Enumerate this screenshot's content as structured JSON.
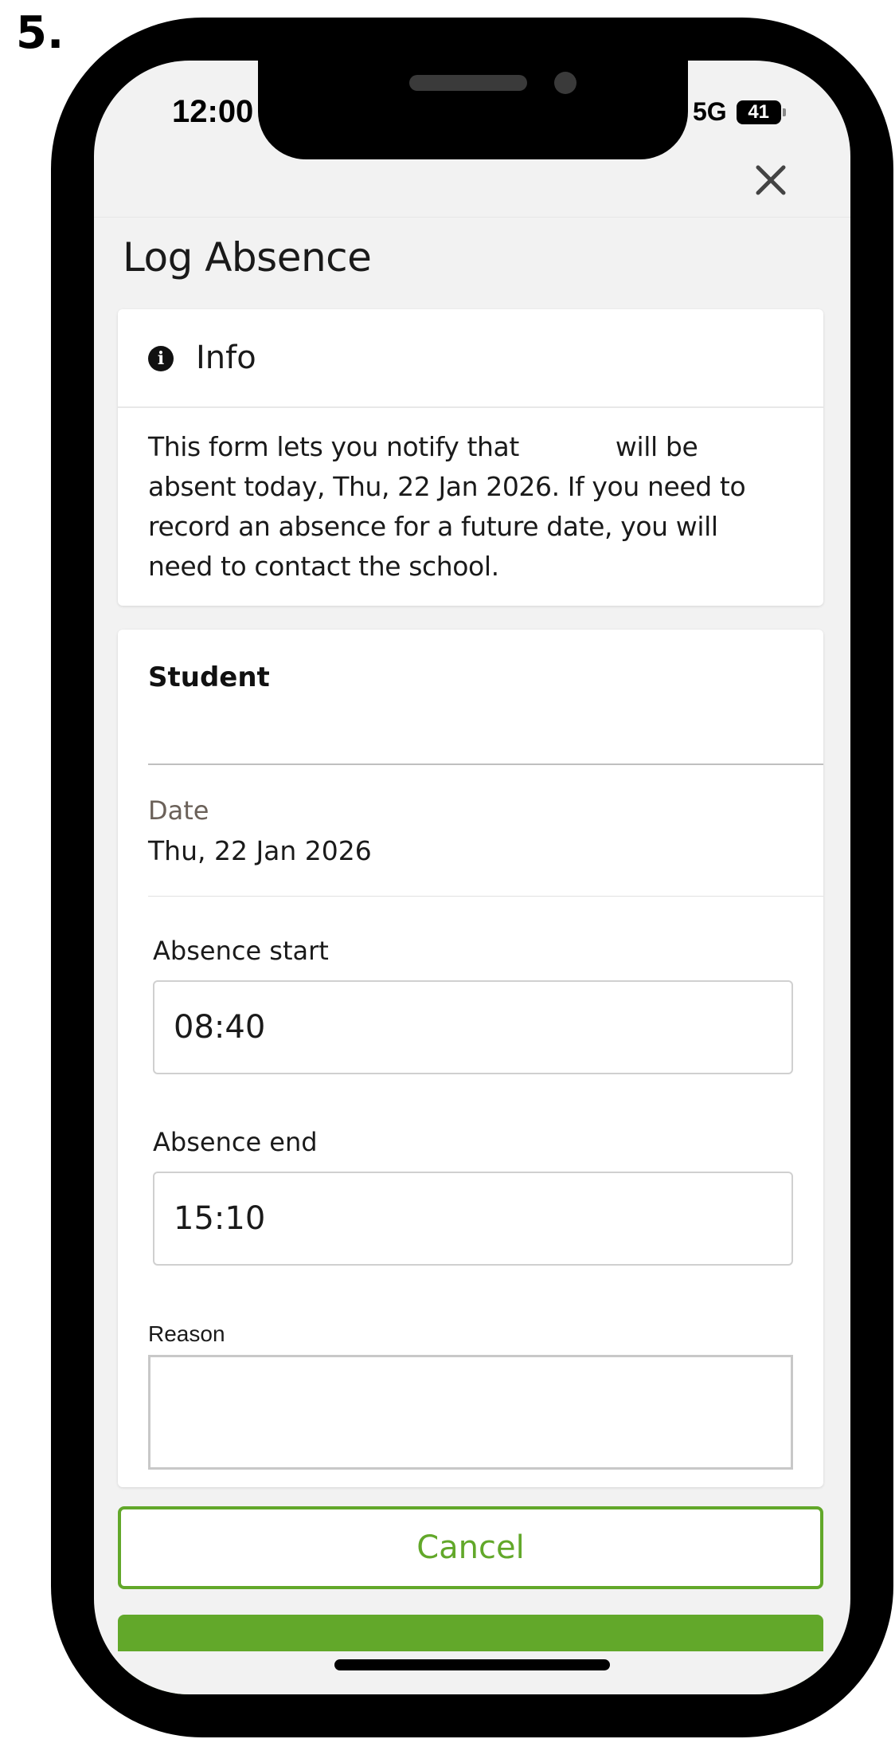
{
  "step_label": "5.",
  "status_bar": {
    "time": "12:00",
    "network": "5G",
    "battery": "41"
  },
  "page_title": "Log Absence",
  "info": {
    "title": "Info",
    "body": "This form lets you notify that            will be absent today, Thu, 22 Jan 2026. If you need to record an absence for a future date, you will need to contact the school."
  },
  "form": {
    "student_label": "Student",
    "date_label": "Date",
    "date_value": "Thu, 22 Jan 2026",
    "absence_start_label": "Absence start",
    "absence_start_value": "08:40",
    "absence_end_label": "Absence end",
    "absence_end_value": "15:10",
    "reason_label": "Reason",
    "reason_value": ""
  },
  "buttons": {
    "cancel": "Cancel"
  },
  "colors": {
    "accent": "#62a82a",
    "date_label": "#6b6159"
  }
}
